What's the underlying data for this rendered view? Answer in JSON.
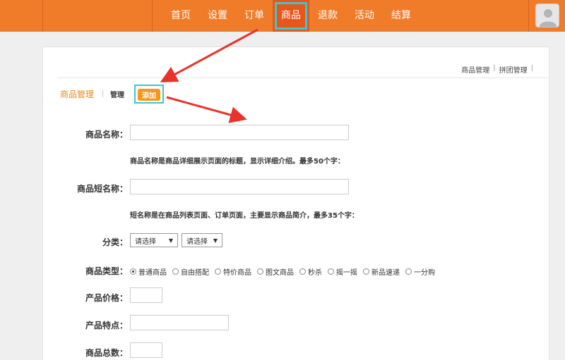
{
  "nav": {
    "items": [
      {
        "label": "首页"
      },
      {
        "label": "设置"
      },
      {
        "label": "订单"
      },
      {
        "label": "商品"
      },
      {
        "label": "退款"
      },
      {
        "label": "活动"
      },
      {
        "label": "结算"
      }
    ],
    "active_index": 3
  },
  "toplinks": {
    "product_manage": "商品管理",
    "sep1": "|",
    "group_manage": "拼团管理",
    "sep2": "|"
  },
  "tabs": {
    "title": "商品管理",
    "manage": "管理",
    "add": "添加"
  },
  "form": {
    "name_label": "商品名称：",
    "name_value": "",
    "name_hint": "商品名称是商品详细展示页面的标题，显示详细介绍。最多50个字：",
    "short_name_label": "商品短名称：",
    "short_name_value": "",
    "short_name_hint": "短名称是在商品列表页面、订单页面，主要显示商品简介，最多35个字：",
    "category_label": "分类：",
    "category_select1": "请选择",
    "category_select2": "请选择",
    "type_label": "商品类型：",
    "type_options": [
      "普通商品",
      "自由搭配",
      "特价商品",
      "图文商品",
      "秒杀",
      "摇一摇",
      "新品速递",
      "一分购"
    ],
    "type_selected": 0,
    "price_label": "产品价格：",
    "feature_label": "产品特点：",
    "total_label": "商品总数："
  },
  "colors": {
    "topbar": "#f07c2a",
    "accent": "#e68a1a",
    "highlight": "#3fc6c8",
    "arrow": "#e8322a"
  }
}
